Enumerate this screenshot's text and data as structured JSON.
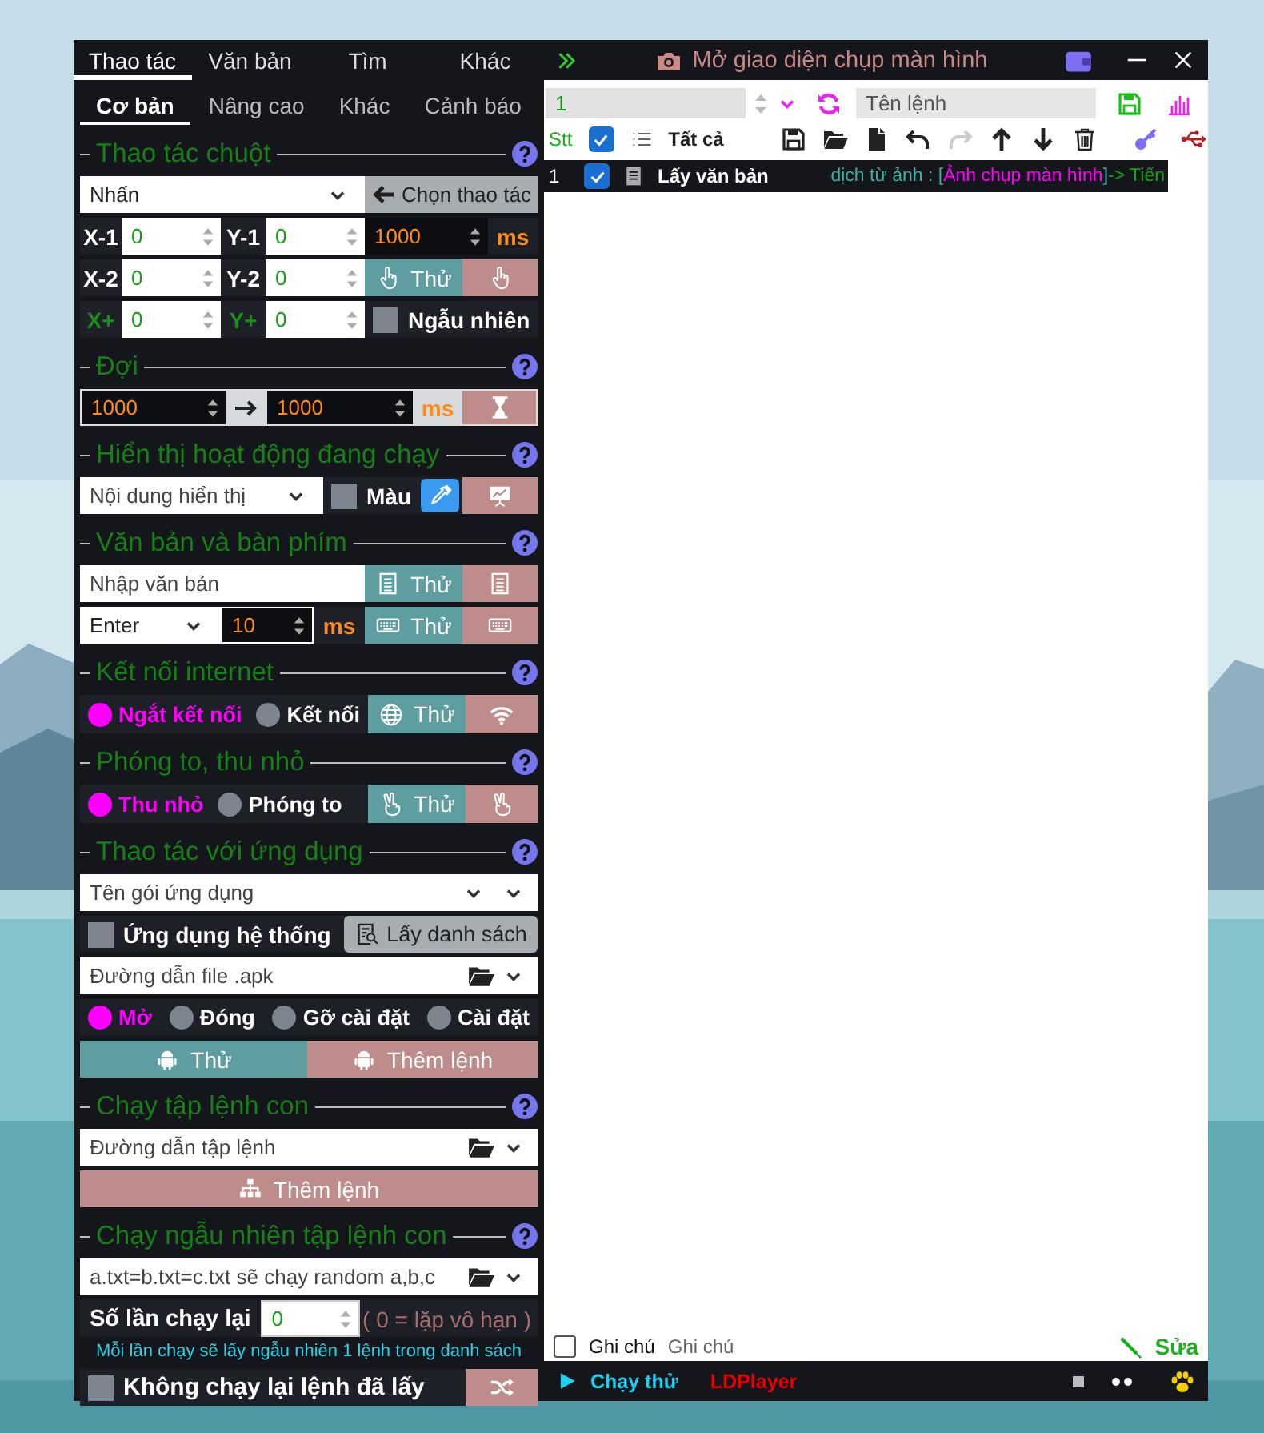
{
  "window": {
    "capture_button": "Mở giao diện chụp màn hình"
  },
  "main_tabs": [
    {
      "label": "Thao tác",
      "selected": true
    },
    {
      "label": "Văn bản",
      "selected": false
    },
    {
      "label": "Tìm",
      "selected": false
    },
    {
      "label": "Khác",
      "selected": false
    }
  ],
  "sub_tabs": [
    {
      "label": "Cơ bản",
      "selected": true
    },
    {
      "label": "Nâng cao",
      "selected": false
    },
    {
      "label": "Khác",
      "selected": false
    },
    {
      "label": "Cảnh báo",
      "selected": false
    }
  ],
  "sections": [
    {
      "kind": "mouse",
      "title": "Thao tác chuột",
      "action": "Nhấn",
      "pick_button": "Chọn thao tác",
      "coordinates": [
        {
          "x_label": "X-1",
          "x_value": "0",
          "y_label": "Y-1",
          "y_value": "0"
        },
        {
          "x_label": "X-2",
          "x_value": "0",
          "y_label": "Y-2",
          "y_value": "0"
        },
        {
          "x_label": "X+",
          "x_value": "0",
          "y_label": "Y+",
          "y_value": "0"
        }
      ],
      "delay": "1000",
      "delay_unit": "ms",
      "test_button": "Thử",
      "random": {
        "label": "Ngẫu nhiên",
        "checked": false
      }
    },
    {
      "kind": "wait",
      "title": "Đợi",
      "from": "1000",
      "to": "1000",
      "unit": "ms"
    },
    {
      "kind": "display",
      "title": "Hiển thị hoạt động đang chạy",
      "content": {
        "placeholder": "Nội dung hiển thị"
      },
      "color": {
        "label": "Màu",
        "checked": false
      }
    },
    {
      "kind": "keyboard",
      "title": "Văn bản và bàn phím",
      "text": {
        "placeholder": "Nhập văn bản"
      },
      "text_test_button": "Thử",
      "key": "Enter",
      "key_delay": "10",
      "key_delay_unit": "ms",
      "key_test_button": "Thử"
    },
    {
      "kind": "internet",
      "title": "Kết nối internet",
      "options": [
        {
          "label": "Ngắt kết nối",
          "selected": true
        },
        {
          "label": "Kết nối",
          "selected": false
        }
      ],
      "test_button": "Thử"
    },
    {
      "kind": "window",
      "title": "Phóng to, thu nhỏ",
      "options": [
        {
          "label": "Thu nhỏ",
          "selected": true
        },
        {
          "label": "Phóng to",
          "selected": false
        }
      ],
      "test_button": "Thử"
    },
    {
      "kind": "app",
      "title": "Thao tác với ứng dụng",
      "package": {
        "placeholder": "Tên gói ứng dụng"
      },
      "system": {
        "label": "Ứng dụng hệ thống",
        "checked": false
      },
      "list_button": "Lấy danh sách",
      "apk": {
        "placeholder": "Đường dẫn file .apk"
      },
      "options": [
        {
          "label": "Mở",
          "selected": true
        },
        {
          "label": "Đóng",
          "selected": false
        },
        {
          "label": "Gỡ cài đặt",
          "selected": false
        },
        {
          "label": "Cài đặt",
          "selected": false
        }
      ],
      "test_button": "Thử",
      "add_button": "Thêm lệnh"
    },
    {
      "kind": "script",
      "title": "Chạy tập lệnh con",
      "path": {
        "placeholder": "Đường dẫn tập lệnh"
      },
      "add_button": "Thêm lệnh"
    },
    {
      "kind": "random",
      "title": "Chạy ngẫu nhiên tập lệnh con",
      "path": {
        "placeholder": "a.txt=b.txt=c.txt sẽ chạy random a,b,c"
      },
      "repeat_label": "Số lần chạy lại",
      "repeat_value": "0",
      "repeat_note": "( 0 = lặp vô hạn )",
      "hint": "Mỗi lần chạy sẽ lấy ngẫu nhiên 1 lệnh trong danh sách",
      "no_repeat": {
        "label": "Không chạy lại lệnh đã lấy",
        "checked": false
      }
    }
  ],
  "command_bar": {
    "index": "1",
    "name": {
      "placeholder": "Tên lệnh"
    }
  },
  "list_header": {
    "number_label": "Stt",
    "all_checked": true,
    "all_label": "Tất cả"
  },
  "commands": [
    {
      "number": "1",
      "checked": true,
      "name": "Lấy văn bản",
      "detail": [
        {
          "kind": "label",
          "text": "dịch từ ảnh : ["
        },
        {
          "kind": "value",
          "text": "Ảnh chụp màn hình"
        },
        {
          "kind": "label",
          "text": "]"
        },
        {
          "kind": "result",
          "text": "-> Tiến"
        }
      ]
    }
  ],
  "note": {
    "checked": false,
    "label": "Ghi chú",
    "placeholder": "Ghi chú",
    "edit_button": "Sửa"
  },
  "status_bar": {
    "run_button": "Chạy thử",
    "device": "LDPlayer"
  }
}
